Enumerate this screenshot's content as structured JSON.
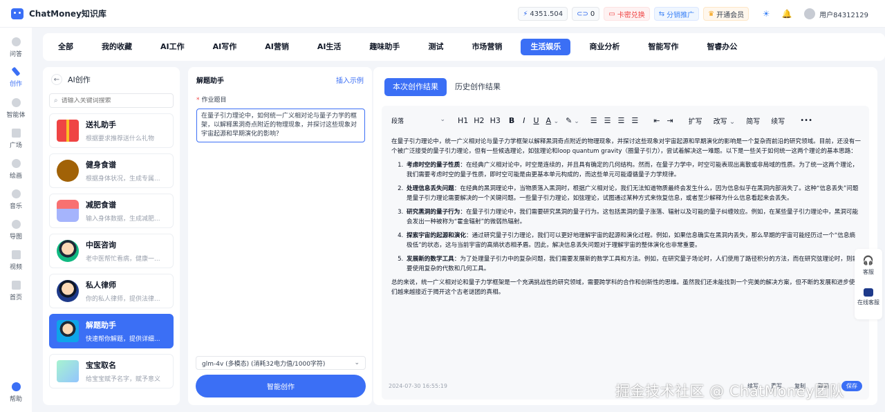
{
  "app": {
    "name": "ChatMoney知识库"
  },
  "top": {
    "balance": "4351.504",
    "count": "0",
    "card_exchange": "卡密兑换",
    "distribution": "分销推广",
    "membership": "开通会员",
    "user": "用户84312129"
  },
  "sidebar": {
    "items": [
      {
        "label": "问答",
        "icon": "chat-icon"
      },
      {
        "label": "创作",
        "icon": "pen-icon"
      },
      {
        "label": "智能体",
        "icon": "agent-icon"
      },
      {
        "label": "广场",
        "icon": "grid-icon"
      },
      {
        "label": "绘画",
        "icon": "palette-icon"
      },
      {
        "label": "音乐",
        "icon": "music-icon"
      },
      {
        "label": "导图",
        "icon": "mindmap-icon"
      },
      {
        "label": "视频",
        "icon": "video-icon"
      },
      {
        "label": "首页",
        "icon": "home-icon"
      }
    ],
    "help": "帮助"
  },
  "categories": [
    "全部",
    "我的收藏",
    "AI工作",
    "AI写作",
    "AI营销",
    "AI生活",
    "趣味助手",
    "测试",
    "市场营销",
    "生活娱乐",
    "商业分析",
    "智能写作",
    "智睿办公"
  ],
  "active_category": "生活娱乐",
  "list": {
    "title": "AI创作",
    "search_placeholder": "请输入关键词搜索",
    "cards": [
      {
        "title": "送礼助手",
        "desc": "根据要求推荐送什么礼物"
      },
      {
        "title": "健身食谱",
        "desc": "根据身体状况，生成专属..."
      },
      {
        "title": "减肥食谱",
        "desc": "输入身体数据，生成减肥..."
      },
      {
        "title": "中医咨询",
        "desc": "老中医帮忙看病，健康一..."
      },
      {
        "title": "私人律师",
        "desc": "你的私人律师，提供法律..."
      },
      {
        "title": "解题助手",
        "desc": "快速帮你解题，提供详细..."
      },
      {
        "title": "宝宝取名",
        "desc": "给宝宝赋予名字，赋予意义"
      }
    ]
  },
  "form": {
    "title": "解题助手",
    "insert_example": "插入示例",
    "field_label": "作业题目",
    "question": "在量子引力理论中，如何统一广义相对论与量子力学的框架，以解释黑洞奇点附近的物理现象，并探讨这些现象对宇宙起源和早期演化的影响？",
    "model": "glm-4v (多模态) (消耗32电力值/1000字符)",
    "submit": "智能创作"
  },
  "editor": {
    "tab_current": "本次创作结果",
    "tab_history": "历史创作结果",
    "toolbar": {
      "paragraph": "段落",
      "h1": "H1",
      "h2": "H2",
      "h3": "H3",
      "bold": "B",
      "italic": "I",
      "underline": "U",
      "font_color": "A",
      "expand": "扩写",
      "rewrite": "改写",
      "simplify": "简写",
      "continue": "续写",
      "more": "•••"
    },
    "intro": "在量子引力理论中，统一广义相对论与量子力学框架以解释黑洞奇点附近的物理现象，并探讨这些现象对宇宙起源和早期演化的影响是一个复杂而前沿的研究领域。目前，还没有一个被广泛接受的量子引力理论，但有一些候选理论，如弦理论和loop quantum gravity（圈量子引力），尝试着解决这一难题。以下是一些关于如何统一这两个理论的基本思路：",
    "points": [
      {
        "title": "考虑时空的量子性质",
        "text": "：在经典广义相对论中，时空是连续的，并且具有确定的几何结构。然而，在量子力学中，时空可能表现出离散或非局域的性质。为了统一这两个理论，我们需要考虑时空的量子性质，即时空可能是由更基本单元构成的，而这些单元可能遵循量子力学规律。"
      },
      {
        "title": "处理信息丢失问题",
        "text": "：在经典的黑洞理论中，当物质落入黑洞时，根据广义相对论，我们无法知道物质最终会发生什么，因为信息似乎在黑洞内部消失了。这种“信息丢失”问题是量子引力理论需要解决的一个关键问题。一些量子引力理论，如弦理论，试图通过某种方式来恢复信息，或者至少解释为什么信息看起来会丢失。"
      },
      {
        "title": "研究黑洞的量子行为",
        "text": "：在量子引力理论中，我们需要研究黑洞的量子行为。这包括黑洞的量子涨落、辐射以及可能的量子纠缠效应。例如，在某些量子引力理论中，黑洞可能会发出一种被称为“霍金辐射”的微弱热辐射。"
      },
      {
        "title": "探索宇宙的起源和演化",
        "text": "：通过研究量子引力理论，我们可以更好地理解宇宙的起源和演化过程。例如，如果信息确实在黑洞内丢失，那么早期的宇宙可能经历过一个“信息熵极低”的状态，这与当前宇宙的高熵状态相矛盾。因此，解决信息丢失问题对于理解宇宙的整体演化也非常重要。"
      },
      {
        "title": "发展新的数学工具",
        "text": "：为了处理量子引力中的复杂问题，我们需要发展新的数学工具和方法。例如，在研究量子场论时，人们使用了路径积分的方法，而在研究弦理论时，则需要使用复杂的代数和几何工具。"
      }
    ],
    "conclusion": "总的来说，统一广义相对论和量子力学框架是一个充满挑战性的研究领域，需要跨学科的合作和创新性的思维。虽然我们还未能找到一个完美的解决方案，但不断的发展和进步使我们越来越接近于揭开这个古老谜团的真相。",
    "timestamp": "2024-07-30 16:55:19",
    "actions": {
      "continue": "续写",
      "rewrite": "重写",
      "copy": "复制",
      "cancel": "取消",
      "save": "保存"
    }
  },
  "float": {
    "service": "客服",
    "online": "在线客服"
  },
  "watermark": "掘金技术社区 @ ChatMoney团队",
  "colors": {
    "accent": "#3b6ff5",
    "danger": "#ef4444"
  }
}
